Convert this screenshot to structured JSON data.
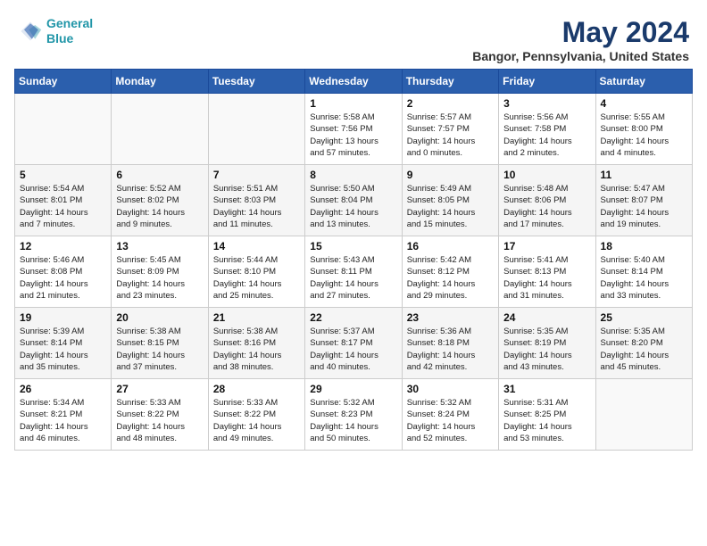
{
  "header": {
    "logo_line1": "General",
    "logo_line2": "Blue",
    "month": "May 2024",
    "location": "Bangor, Pennsylvania, United States"
  },
  "days_of_week": [
    "Sunday",
    "Monday",
    "Tuesday",
    "Wednesday",
    "Thursday",
    "Friday",
    "Saturday"
  ],
  "weeks": [
    [
      {
        "day": "",
        "info": ""
      },
      {
        "day": "",
        "info": ""
      },
      {
        "day": "",
        "info": ""
      },
      {
        "day": "1",
        "info": "Sunrise: 5:58 AM\nSunset: 7:56 PM\nDaylight: 13 hours\nand 57 minutes."
      },
      {
        "day": "2",
        "info": "Sunrise: 5:57 AM\nSunset: 7:57 PM\nDaylight: 14 hours\nand 0 minutes."
      },
      {
        "day": "3",
        "info": "Sunrise: 5:56 AM\nSunset: 7:58 PM\nDaylight: 14 hours\nand 2 minutes."
      },
      {
        "day": "4",
        "info": "Sunrise: 5:55 AM\nSunset: 8:00 PM\nDaylight: 14 hours\nand 4 minutes."
      }
    ],
    [
      {
        "day": "5",
        "info": "Sunrise: 5:54 AM\nSunset: 8:01 PM\nDaylight: 14 hours\nand 7 minutes."
      },
      {
        "day": "6",
        "info": "Sunrise: 5:52 AM\nSunset: 8:02 PM\nDaylight: 14 hours\nand 9 minutes."
      },
      {
        "day": "7",
        "info": "Sunrise: 5:51 AM\nSunset: 8:03 PM\nDaylight: 14 hours\nand 11 minutes."
      },
      {
        "day": "8",
        "info": "Sunrise: 5:50 AM\nSunset: 8:04 PM\nDaylight: 14 hours\nand 13 minutes."
      },
      {
        "day": "9",
        "info": "Sunrise: 5:49 AM\nSunset: 8:05 PM\nDaylight: 14 hours\nand 15 minutes."
      },
      {
        "day": "10",
        "info": "Sunrise: 5:48 AM\nSunset: 8:06 PM\nDaylight: 14 hours\nand 17 minutes."
      },
      {
        "day": "11",
        "info": "Sunrise: 5:47 AM\nSunset: 8:07 PM\nDaylight: 14 hours\nand 19 minutes."
      }
    ],
    [
      {
        "day": "12",
        "info": "Sunrise: 5:46 AM\nSunset: 8:08 PM\nDaylight: 14 hours\nand 21 minutes."
      },
      {
        "day": "13",
        "info": "Sunrise: 5:45 AM\nSunset: 8:09 PM\nDaylight: 14 hours\nand 23 minutes."
      },
      {
        "day": "14",
        "info": "Sunrise: 5:44 AM\nSunset: 8:10 PM\nDaylight: 14 hours\nand 25 minutes."
      },
      {
        "day": "15",
        "info": "Sunrise: 5:43 AM\nSunset: 8:11 PM\nDaylight: 14 hours\nand 27 minutes."
      },
      {
        "day": "16",
        "info": "Sunrise: 5:42 AM\nSunset: 8:12 PM\nDaylight: 14 hours\nand 29 minutes."
      },
      {
        "day": "17",
        "info": "Sunrise: 5:41 AM\nSunset: 8:13 PM\nDaylight: 14 hours\nand 31 minutes."
      },
      {
        "day": "18",
        "info": "Sunrise: 5:40 AM\nSunset: 8:14 PM\nDaylight: 14 hours\nand 33 minutes."
      }
    ],
    [
      {
        "day": "19",
        "info": "Sunrise: 5:39 AM\nSunset: 8:14 PM\nDaylight: 14 hours\nand 35 minutes."
      },
      {
        "day": "20",
        "info": "Sunrise: 5:38 AM\nSunset: 8:15 PM\nDaylight: 14 hours\nand 37 minutes."
      },
      {
        "day": "21",
        "info": "Sunrise: 5:38 AM\nSunset: 8:16 PM\nDaylight: 14 hours\nand 38 minutes."
      },
      {
        "day": "22",
        "info": "Sunrise: 5:37 AM\nSunset: 8:17 PM\nDaylight: 14 hours\nand 40 minutes."
      },
      {
        "day": "23",
        "info": "Sunrise: 5:36 AM\nSunset: 8:18 PM\nDaylight: 14 hours\nand 42 minutes."
      },
      {
        "day": "24",
        "info": "Sunrise: 5:35 AM\nSunset: 8:19 PM\nDaylight: 14 hours\nand 43 minutes."
      },
      {
        "day": "25",
        "info": "Sunrise: 5:35 AM\nSunset: 8:20 PM\nDaylight: 14 hours\nand 45 minutes."
      }
    ],
    [
      {
        "day": "26",
        "info": "Sunrise: 5:34 AM\nSunset: 8:21 PM\nDaylight: 14 hours\nand 46 minutes."
      },
      {
        "day": "27",
        "info": "Sunrise: 5:33 AM\nSunset: 8:22 PM\nDaylight: 14 hours\nand 48 minutes."
      },
      {
        "day": "28",
        "info": "Sunrise: 5:33 AM\nSunset: 8:22 PM\nDaylight: 14 hours\nand 49 minutes."
      },
      {
        "day": "29",
        "info": "Sunrise: 5:32 AM\nSunset: 8:23 PM\nDaylight: 14 hours\nand 50 minutes."
      },
      {
        "day": "30",
        "info": "Sunrise: 5:32 AM\nSunset: 8:24 PM\nDaylight: 14 hours\nand 52 minutes."
      },
      {
        "day": "31",
        "info": "Sunrise: 5:31 AM\nSunset: 8:25 PM\nDaylight: 14 hours\nand 53 minutes."
      },
      {
        "day": "",
        "info": ""
      }
    ]
  ]
}
